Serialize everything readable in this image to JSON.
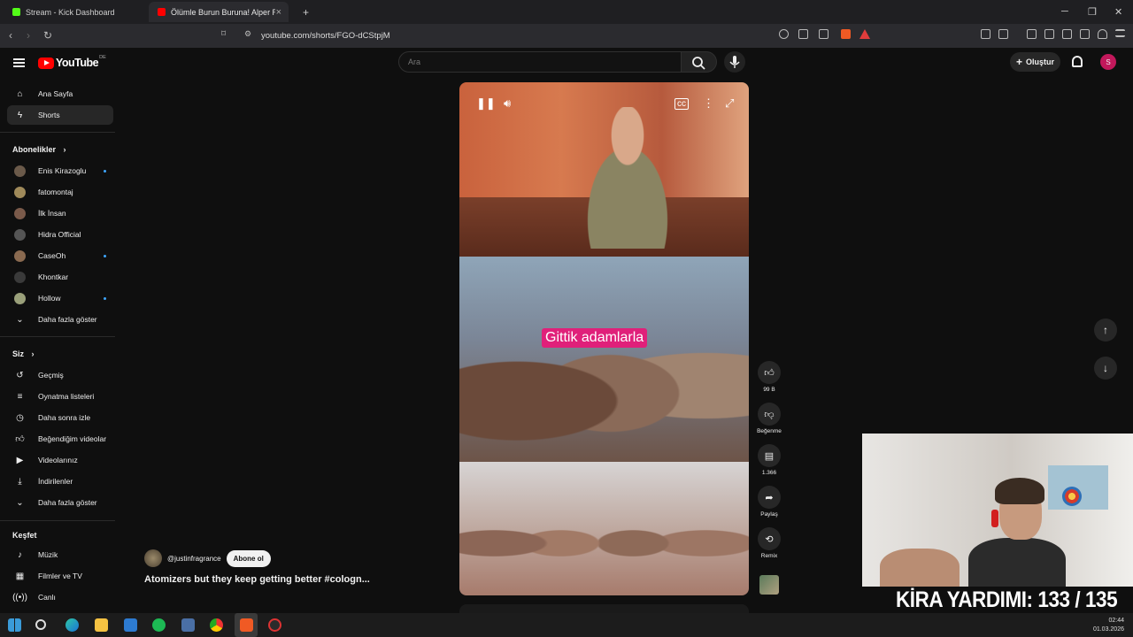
{
  "browser": {
    "tabs": [
      {
        "title": "Stream - Kick Dashboard",
        "favicon_color": "#53fc18"
      },
      {
        "title": "Ölümle Burun Buruna! Alper R",
        "favicon_color": "#ff0000"
      }
    ],
    "new_tab": "+",
    "url": "youtube.com/shorts/FGO-dCStpjM",
    "window_controls": {
      "minimize": "─",
      "maximize": "❐",
      "close": "✕"
    }
  },
  "youtube": {
    "logo_text": "YouTube",
    "country_code": "DE",
    "search_placeholder": "Ara",
    "create_label": "Oluştur",
    "avatar_letter": "S"
  },
  "sidebar": {
    "main": [
      {
        "label": "Ana Sayfa",
        "icon": "home-icon"
      },
      {
        "label": "Shorts",
        "icon": "shorts-icon",
        "active": true
      }
    ],
    "subscriptions_header": "Abonelikler",
    "subscriptions": [
      {
        "label": "Enis Kirazoglu",
        "dot": true,
        "color": "#6b5a4a"
      },
      {
        "label": "fatomontaj",
        "dot": false,
        "color": "#a08a5a"
      },
      {
        "label": "İlk İnsan",
        "dot": false,
        "color": "#7a5a4a"
      },
      {
        "label": "Hidra Official",
        "dot": false,
        "color": "#555555"
      },
      {
        "label": "CaseOh",
        "dot": true,
        "color": "#8a6a50"
      },
      {
        "label": "Khontkar",
        "dot": false,
        "color": "#3a3a3a"
      },
      {
        "label": "Hollow",
        "dot": true,
        "color": "#9aa07a"
      }
    ],
    "show_more": "Daha fazla göster",
    "you_header": "Siz",
    "you": [
      {
        "label": "Geçmiş",
        "icon": "history-icon"
      },
      {
        "label": "Oynatma listeleri",
        "icon": "playlist-icon"
      },
      {
        "label": "Daha sonra izle",
        "icon": "clock-icon"
      },
      {
        "label": "Beğendiğim videolar",
        "icon": "thumb-up-icon"
      },
      {
        "label": "Videolarınız",
        "icon": "video-icon"
      },
      {
        "label": "İndirilenler",
        "icon": "download-icon"
      }
    ],
    "show_more_2": "Daha fazla göster",
    "explore_header": "Keşfet",
    "explore": [
      {
        "label": "Müzik",
        "icon": "music-icon"
      },
      {
        "label": "Filmler ve TV",
        "icon": "film-icon"
      },
      {
        "label": "Canlı",
        "icon": "live-icon"
      }
    ]
  },
  "short": {
    "caption": "Gittik adamlarla",
    "channel": "@justinfragrance",
    "subscribe_label": "Abone ol",
    "title": "Atomizers but they keep getting better #cologn..."
  },
  "actions": {
    "like_count": "99 B",
    "dislike_label": "Beğenme",
    "comment_count": "1.366",
    "share_label": "Paylaş",
    "remix_label": "Remix"
  },
  "overlay": {
    "kira_text": "KİRA YARDIMI: 133 / 135"
  },
  "taskbar": {
    "time": "02:44",
    "date": "01.03.2026"
  }
}
